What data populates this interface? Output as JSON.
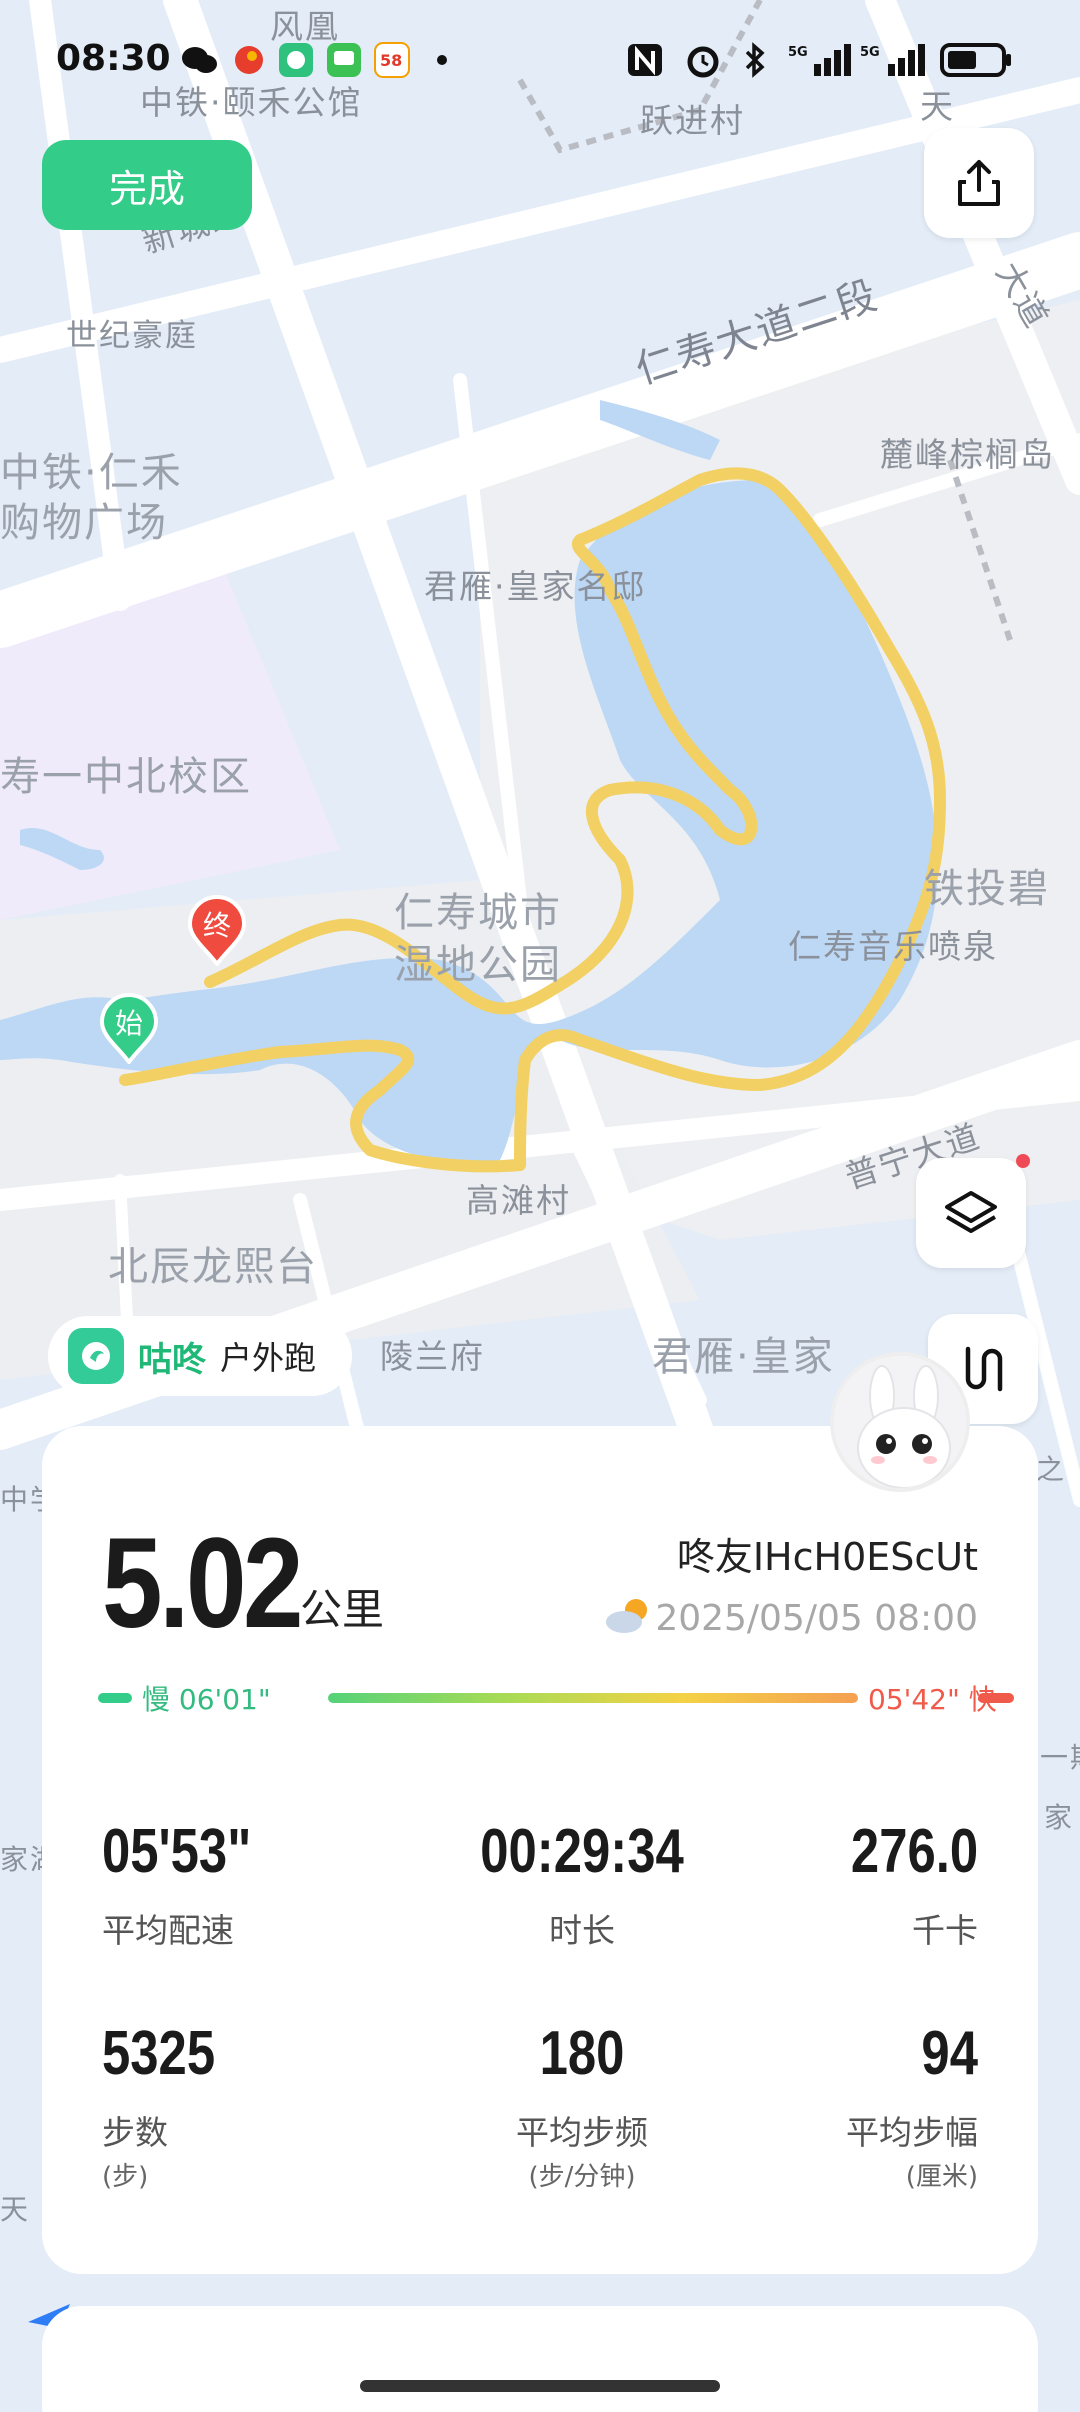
{
  "status_bar": {
    "time": "08:30",
    "icons": [
      "wechat-icon",
      "app-icon",
      "gudong-icon",
      "message-icon",
      "58-icon",
      "dot-icon",
      "nfc-icon",
      "alarm-icon",
      "bluetooth-icon",
      "signal-5g-icon",
      "signal-5g-icon",
      "battery-icon"
    ]
  },
  "map": {
    "labels": [
      "风凰",
      "中铁·颐禾公馆",
      "跃进村",
      "天",
      "新城路",
      "世纪豪庭",
      "仁寿大道二段",
      "大道",
      "麓峰棕榈岛",
      "中铁·仁禾",
      "购物广场",
      "君雁·皇家名邸",
      "寿一中北校区",
      "仁寿城市",
      "湿地公园",
      "铁投碧",
      "仁寿音乐喷泉",
      "普宁大道",
      "高滩村",
      "北辰龙熙台",
      "陵兰府",
      "君雁·皇家",
      "中学",
      "之",
      "一期",
      "家",
      "家湖",
      "天"
    ],
    "markers": {
      "end": "终",
      "start": "始"
    },
    "route_color": "#f2d063"
  },
  "buttons": {
    "done": "完成",
    "share": "share-icon",
    "layers": "layers-icon",
    "route": "route-icon"
  },
  "source": {
    "brand": "咕咚",
    "type": "户外跑"
  },
  "summary": {
    "distance": "5.02",
    "distance_unit": "公里",
    "user": "咚友IHcH0EScUt",
    "datetime": "2025/05/05 08:00",
    "pace_slow_label": "慢 06'01\"",
    "pace_fast_label": "05'42\" 快"
  },
  "stats": [
    {
      "value": "05'53\"",
      "label": "平均配速",
      "unit": ""
    },
    {
      "value": "00:29:34",
      "label": "时长",
      "unit": ""
    },
    {
      "value": "276.0",
      "label": "千卡",
      "unit": ""
    },
    {
      "value": "5325",
      "label": "步数",
      "unit": "(步)"
    },
    {
      "value": "180",
      "label": "平均步频",
      "unit": "(步/分钟)"
    },
    {
      "value": "94",
      "label": "平均步幅",
      "unit": "(厘米)"
    }
  ],
  "colors": {
    "accent": "#33cc88",
    "pace_slow": "#33cc88",
    "pace_fast": "#f05a4a"
  }
}
